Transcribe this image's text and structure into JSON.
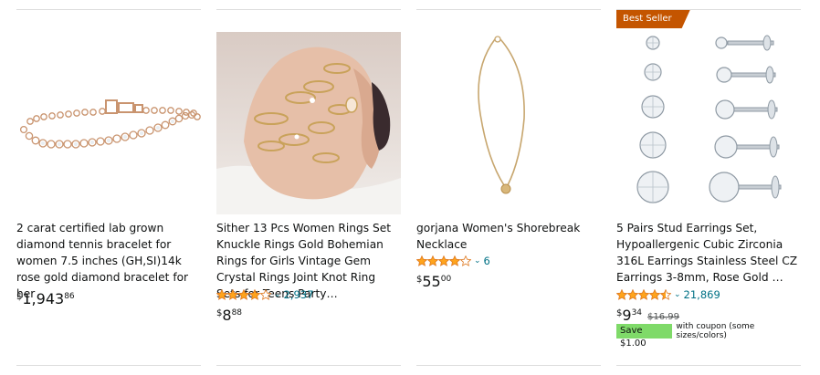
{
  "products": [
    {
      "title": "2 carat certified lab grown diamond tennis bracelet for women 7.5 inches (GH,SI)14k rose gold diamond bracelet for her",
      "price": {
        "symbol": "$",
        "whole": "1,943",
        "fraction": "86"
      },
      "image": "rose-gold-tennis-bracelet"
    },
    {
      "title": "Sither 13 Pcs Women Rings Set Knuckle Rings Gold Bohemian Rings for Girls Vintage Gem Crystal Rings Joint Knot Ring Sets for Teens Party…",
      "rating": 4.0,
      "review_count": "2,937",
      "price": {
        "symbol": "$",
        "whole": "8",
        "fraction": "88"
      },
      "image": "hand-with-gold-rings"
    },
    {
      "title": "gorjana Women's Shorebreak Necklace",
      "rating": 4.0,
      "review_count": "6",
      "price": {
        "symbol": "$",
        "whole": "55",
        "fraction": "00"
      },
      "image": "gold-pendant-necklace"
    },
    {
      "badge": "Best Seller",
      "title": "5 Pairs Stud Earrings Set, Hypoallergenic Cubic Zirconia 316L Earrings Stainless Steel CZ Earrings 3-8mm, Rose Gold …",
      "rating": 4.5,
      "review_count": "21,869",
      "price": {
        "symbol": "$",
        "whole": "9",
        "fraction": "34"
      },
      "list_price": "$16.99",
      "coupon": {
        "label": "Save $1.00",
        "text": "with coupon (some sizes/colors)"
      },
      "image": "cz-stud-earrings-set"
    }
  ],
  "colors": {
    "star": "#ffa41c",
    "link": "#007185",
    "badge": "#c45500",
    "coupon": "#7fda69"
  }
}
